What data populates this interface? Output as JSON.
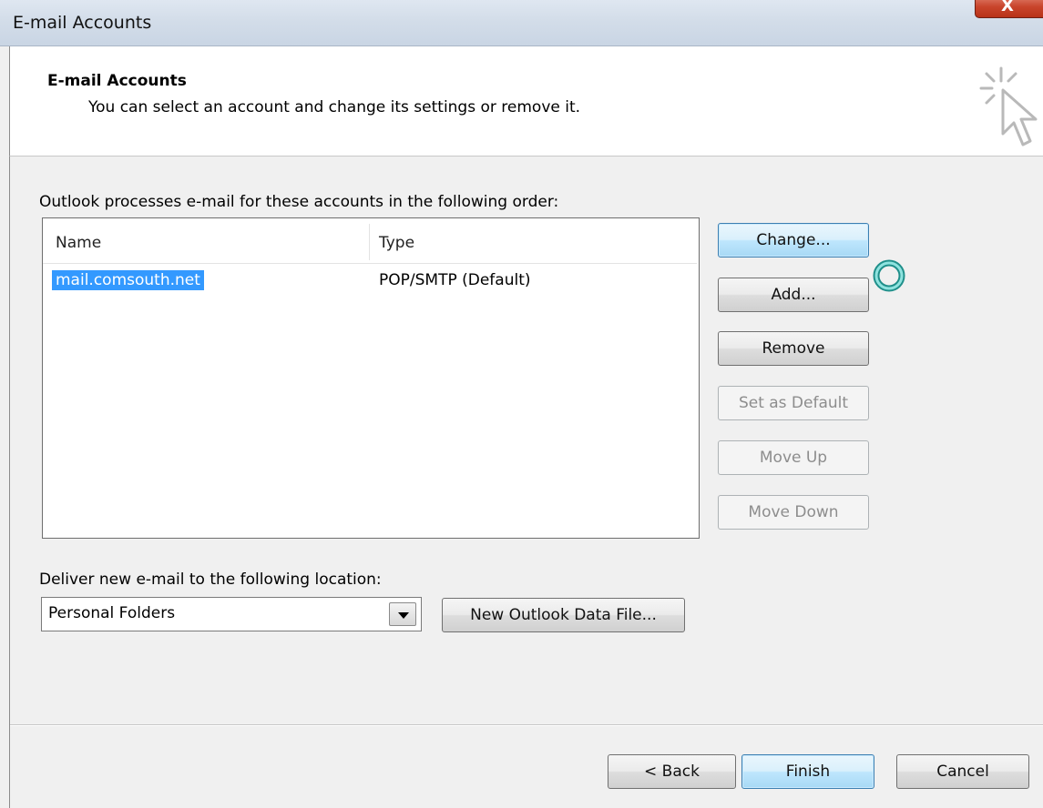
{
  "window": {
    "title": "E-mail Accounts",
    "close_label": "X"
  },
  "header": {
    "title": "E-mail Accounts",
    "subtitle": "You can select an account and change its settings or remove it.",
    "icon": "wizard-cursor-icon"
  },
  "accounts": {
    "order_label": "Outlook processes e-mail for these accounts in the following order:",
    "columns": [
      "Name",
      "Type"
    ],
    "rows": [
      {
        "name": "mail.comsouth.net",
        "type": "POP/SMTP (Default)",
        "selected": true
      }
    ]
  },
  "actions": {
    "change": "Change...",
    "add": "Add...",
    "remove": "Remove",
    "set_default": "Set as Default",
    "move_up": "Move Up",
    "move_down": "Move Down"
  },
  "delivery": {
    "label": "Deliver new e-mail to the following location:",
    "selected": "Personal Folders",
    "new_data_file": "New Outlook Data File..."
  },
  "footer": {
    "back": "< Back",
    "finish": "Finish",
    "cancel": "Cancel"
  },
  "colors": {
    "selection": "#3399ff",
    "focus_button": "#bee6fd",
    "close_button": "#c9452c"
  }
}
